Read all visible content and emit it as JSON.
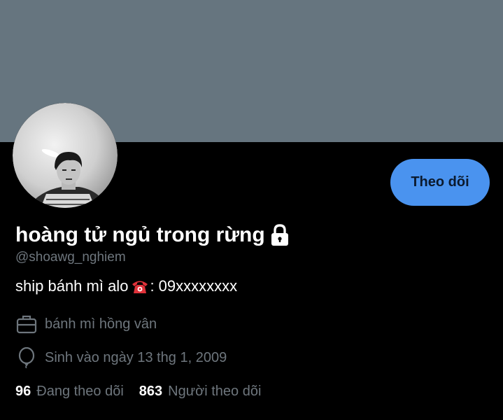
{
  "profile": {
    "banner_color": "#66757f",
    "avatar_alt": "profile photo",
    "follow_button_label": "Theo dõi",
    "accent_color": "#4a93ef",
    "display_name": "hoàng tử ngủ trong rừng",
    "protected_icon": "lock-icon",
    "handle": "@shoawg_nghiem",
    "bio": {
      "before_icon": "ship bánh mì alo",
      "icon": "telephone-icon",
      "after_icon": ": 09xxxxxxxx"
    },
    "work_icon": "briefcase-icon",
    "work": "bánh mì hồng vân",
    "birth_icon": "balloon-icon",
    "birth": "Sinh vào ngày 13 thg 1, 2009",
    "following_count": "96",
    "following_label": "Đang theo dõi",
    "followers_count": "863",
    "followers_label": "Người theo dõi"
  }
}
